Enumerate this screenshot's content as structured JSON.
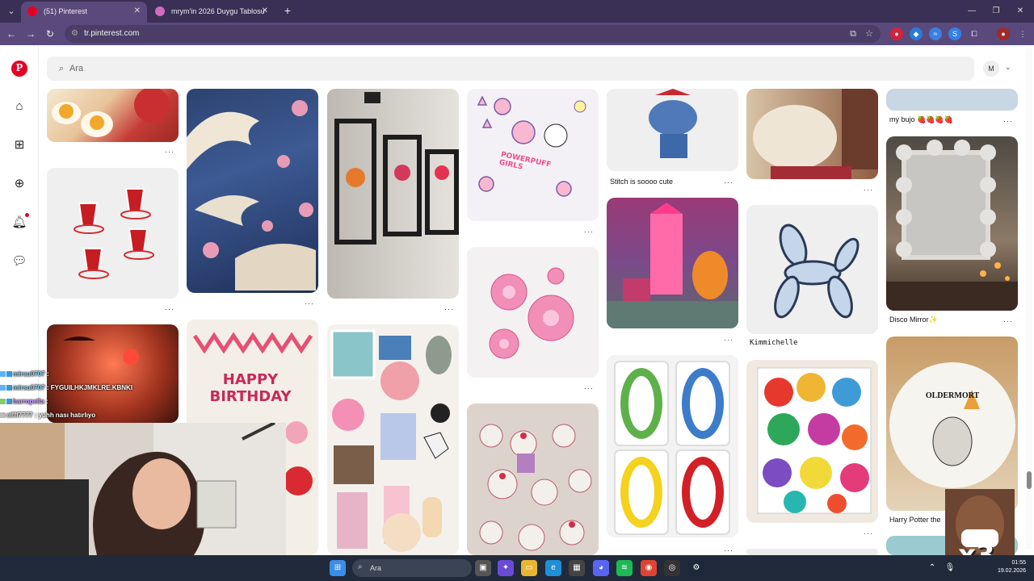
{
  "tabs": [
    {
      "title": "(51) Pinterest",
      "active": true,
      "favicon_color": "#e60023"
    },
    {
      "title": "mrym'in 2026 Duygu Tablosu",
      "active": false,
      "favicon_color": "#d06bbf"
    }
  ],
  "address": {
    "url": "tr.pinterest.com"
  },
  "search": {
    "placeholder": "Ara"
  },
  "account": {
    "initial": "M"
  },
  "pins": {
    "c1": {
      "more": "···"
    },
    "mybujo": {
      "caption": "my bujo 🍓🍓🍓🍓"
    },
    "stitch": {
      "caption": "Stitch is soooo cute"
    },
    "kimmichelle": {
      "caption": "Kimmichelle"
    },
    "disco": {
      "caption": "Disco Mirror✨"
    },
    "harry": {
      "caption": "Harry Potter the"
    },
    "oldermort": {
      "text": "OLDERMORT"
    },
    "birthday": {
      "text": "HAPPY BIRTHDAY"
    },
    "ppg": {
      "text": "POWERPUFF GIRLS"
    }
  },
  "chat": [
    {
      "user": "mirsu0707",
      "message": ":"
    },
    {
      "user": "mirsu0707",
      "message": ": FYGUILHKJMKLRE.KBNKI"
    },
    {
      "user": "barropella",
      "message": ":"
    },
    {
      "user": "elfff7777",
      "message": ": yuhh nası hatırlıyo"
    }
  ],
  "reaction": {
    "text": "x3"
  },
  "taskbar": {
    "search_label": "Ara",
    "time": "01:55",
    "date": "19.02.2026"
  },
  "colors": {
    "accent": "#e60023",
    "chrome_dark": "#3a2f54",
    "chrome": "#5a4a7c",
    "taskbar": "#202a3a"
  }
}
